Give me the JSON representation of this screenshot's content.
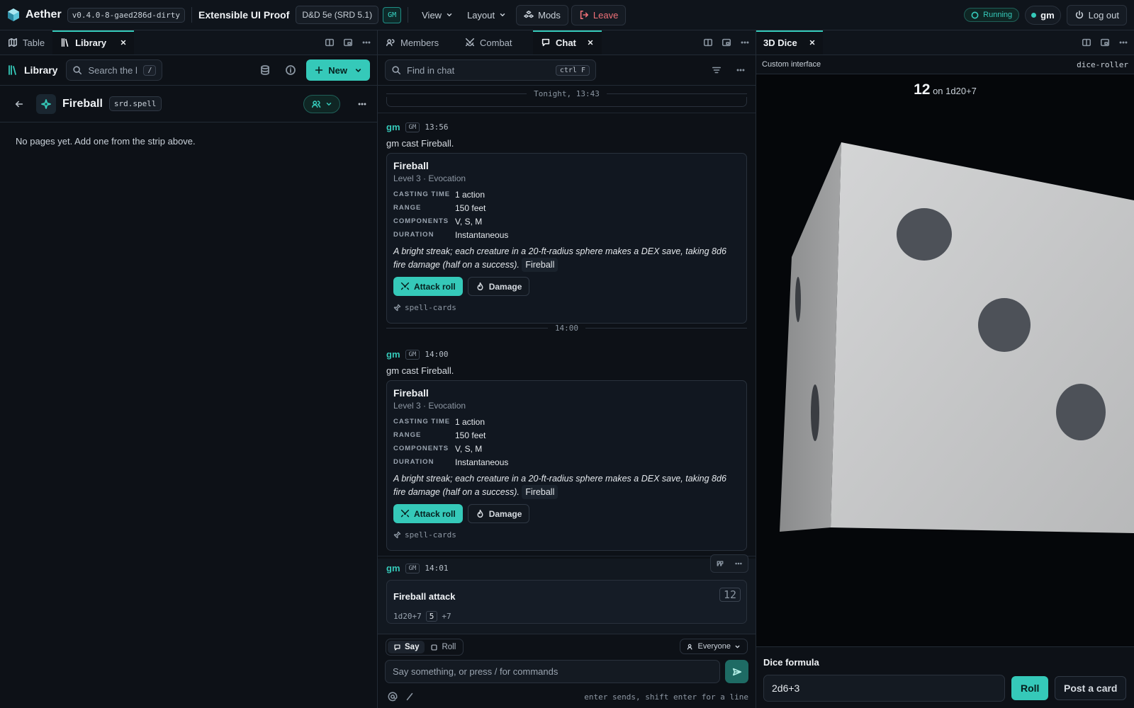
{
  "app": {
    "name": "Aether",
    "version": "v0.4.0-8-gaed286d-dirty"
  },
  "session": {
    "title": "Extensible UI Proof",
    "system": "D&D 5e (SRD 5.1)",
    "role": "GM"
  },
  "topbar": {
    "view": "View",
    "layout": "Layout",
    "mods": "Mods",
    "leave": "Leave",
    "status": "Running",
    "user": "gm",
    "logout": "Log out"
  },
  "left_pane": {
    "tabs": [
      "Table",
      "Library"
    ],
    "library_title": "Library",
    "search_placeholder": "Search the lil",
    "search_key": "/",
    "new_label": "New",
    "entry_title": "Fireball",
    "entry_type": "srd.spell",
    "empty_text": "No pages yet. Add one from the strip above."
  },
  "mid_pane": {
    "tabs": [
      "Members",
      "Combat",
      "Chat"
    ],
    "find_placeholder": "Find in chat",
    "find_key": "ctrl F",
    "divider_top": "Tonight, 13:43",
    "divider_mid": "14:00",
    "messages": [
      {
        "author": "gm",
        "badge": "GM",
        "time": "13:56",
        "text": "gm cast Fireball."
      },
      {
        "author": "gm",
        "badge": "GM",
        "time": "14:00",
        "text": "gm cast Fireball."
      },
      {
        "author": "gm",
        "badge": "GM",
        "time": "14:01"
      }
    ],
    "spell": {
      "name": "Fireball",
      "subtitle": "Level 3 · Evocation",
      "fields": [
        {
          "k": "CASTING TIME",
          "v": "1 action"
        },
        {
          "k": "RANGE",
          "v": "150 feet"
        },
        {
          "k": "COMPONENTS",
          "v": "V, S, M"
        },
        {
          "k": "DURATION",
          "v": "Instantaneous"
        }
      ],
      "desc": "A bright streak; each creature in a 20-ft-radius sphere makes a DEX save, taking 8d6 fire damage (half on a success).",
      "desc_tag": "Fireball",
      "attack_label": "Attack roll",
      "damage_label": "Damage",
      "source": "spell-cards"
    },
    "roll_card": {
      "title": "Fireball attack",
      "total": "12",
      "formula": "1d20+7",
      "die": "5",
      "mod": "+7"
    },
    "composer": {
      "say": "Say",
      "roll": "Roll",
      "audience": "Everyone",
      "placeholder": "Say something, or press / for commands",
      "hint": "enter sends, shift enter for a line"
    }
  },
  "right_pane": {
    "tab": "3D Dice",
    "sub_left": "Custom interface",
    "sub_right": "dice-roller",
    "result_total": "12",
    "result_formula": "on 1d20+7",
    "formula_label": "Dice formula",
    "formula_value": "2d6+3",
    "roll_btn": "Roll",
    "post_btn": "Post a card"
  },
  "colors": {
    "accent": "#35c9b9",
    "danger": "#f07178",
    "background": "#0d1117"
  }
}
